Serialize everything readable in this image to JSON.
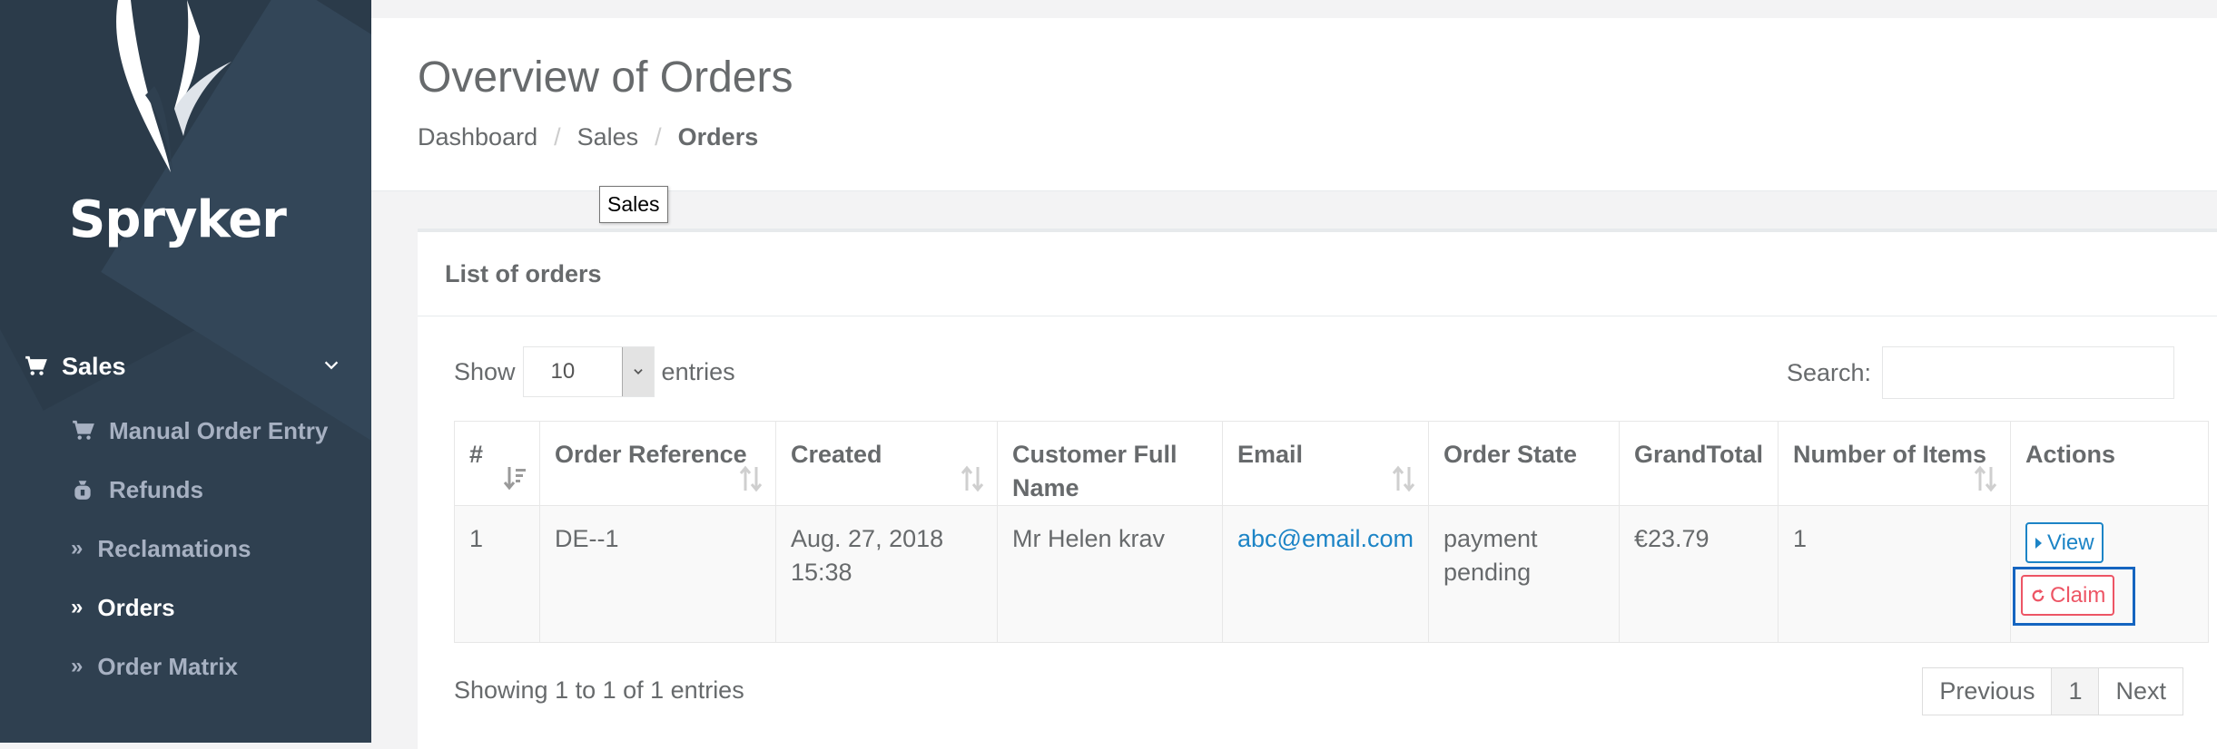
{
  "app": {
    "brand": "Spryker"
  },
  "sidebar": {
    "section": {
      "label": "Sales",
      "icon": "cart-icon"
    },
    "items": [
      {
        "label": "Manual Order Entry",
        "icon": "cart-icon"
      },
      {
        "label": "Refunds",
        "icon": "money-bag-icon"
      },
      {
        "label": "Reclamations",
        "icon": "double-chevron-right-icon"
      },
      {
        "label": "Orders",
        "icon": "double-chevron-right-icon",
        "active": true
      },
      {
        "label": "Order Matrix",
        "icon": "double-chevron-right-icon"
      }
    ]
  },
  "header": {
    "title": "Overview of Orders",
    "breadcrumb": [
      "Dashboard",
      "Sales",
      "Orders"
    ],
    "tooltip": "Sales"
  },
  "panel": {
    "title": "List of orders",
    "show_label": "Show",
    "entries_value": "10",
    "entries_label": "entries",
    "search_label": "Search:",
    "search_value": ""
  },
  "table": {
    "columns": [
      "#",
      "Order Reference",
      "Created",
      "Customer Full Name",
      "Email",
      "Order State",
      "GrandTotal",
      "Number of Items",
      "Actions"
    ],
    "rows": [
      {
        "num": "1",
        "reference": "DE--1",
        "created": "Aug. 27, 2018 15:38",
        "customer": "Mr Helen krav",
        "email": "abc@email.com",
        "state": "payment pending",
        "total": "€23.79",
        "items": "1",
        "view_label": "View",
        "claim_label": "Claim"
      }
    ]
  },
  "footer": {
    "info": "Showing 1 to 1 of 1 entries",
    "pagination": {
      "previous": "Previous",
      "current": "1",
      "next": "Next"
    }
  },
  "colors": {
    "sidebar": "#2f4050",
    "link": "#1c84c6",
    "danger": "#ed5565",
    "focus": "#1565c0"
  }
}
